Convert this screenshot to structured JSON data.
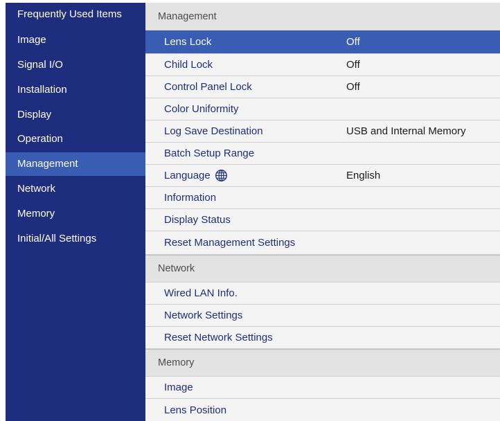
{
  "sidebar": {
    "items": [
      {
        "label": "Frequently Used Items"
      },
      {
        "label": "Image"
      },
      {
        "label": "Signal I/O"
      },
      {
        "label": "Installation"
      },
      {
        "label": "Display"
      },
      {
        "label": "Operation"
      },
      {
        "label": "Management",
        "active": true
      },
      {
        "label": "Network"
      },
      {
        "label": "Memory"
      },
      {
        "label": "Initial/All Settings"
      }
    ]
  },
  "main": {
    "management": {
      "header": "Management",
      "items": [
        {
          "label": "Lens Lock",
          "value": "Off",
          "selected": true
        },
        {
          "label": "Child Lock",
          "value": "Off"
        },
        {
          "label": "Control Panel Lock",
          "value": "Off"
        },
        {
          "label": "Color Uniformity",
          "value": ""
        },
        {
          "label": "Log Save Destination",
          "value": "USB and Internal Memory"
        },
        {
          "label": "Batch Setup Range",
          "value": ""
        },
        {
          "label": "Language",
          "value": "English",
          "icon": "globe-icon"
        },
        {
          "label": "Information",
          "value": ""
        },
        {
          "label": "Display Status",
          "value": ""
        },
        {
          "label": "Reset Management Settings",
          "value": ""
        }
      ]
    },
    "network": {
      "header": "Network",
      "items": [
        {
          "label": "Wired LAN Info."
        },
        {
          "label": "Network Settings"
        },
        {
          "label": "Reset Network Settings"
        }
      ]
    },
    "memory": {
      "header": "Memory",
      "items": [
        {
          "label": "Image"
        },
        {
          "label": "Lens Position"
        }
      ]
    }
  },
  "colors": {
    "sidebar_bg": "#1f2d7e",
    "highlight": "#3a5db4",
    "item_text": "#1f2d7e",
    "section_header_bg": "#e3e3e3"
  }
}
